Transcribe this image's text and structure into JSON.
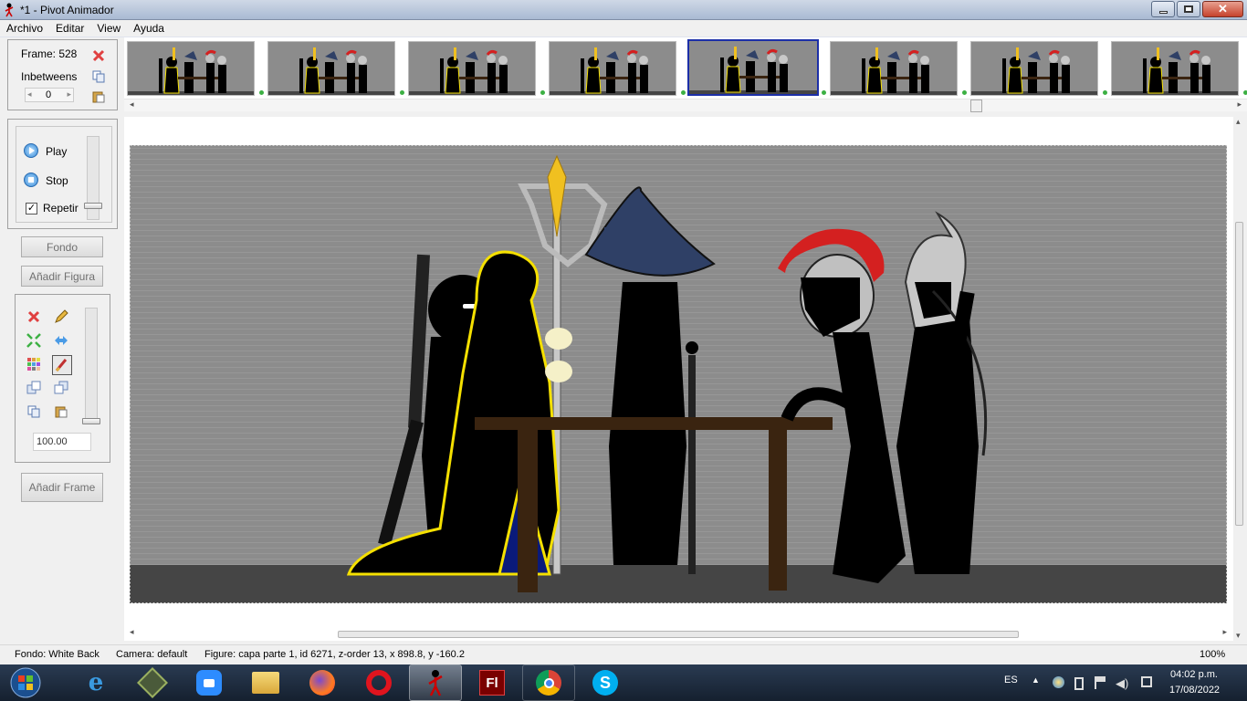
{
  "window": {
    "title": "*1 - Pivot Animador"
  },
  "menu": [
    "Archivo",
    "Editar",
    "View",
    "Ayuda"
  ],
  "frame_panel": {
    "frame_label": "Frame: 528",
    "inbetweens_label": "Inbetweens",
    "inbetweens_value": "0"
  },
  "playback": {
    "play": "Play",
    "stop": "Stop",
    "repeat": "Repetir",
    "repeat_checked": true
  },
  "buttons": {
    "background": "Fondo",
    "add_figure": "Añadir Figura",
    "add_frame": "Añadir Frame"
  },
  "figure_tools": {
    "scale_value": "100.00"
  },
  "icons": [
    "delete-icon",
    "copy-icon",
    "paste-icon",
    "pencil-icon",
    "flip-icon",
    "color-icon",
    "brush-icon",
    "play-icon",
    "stop-icon"
  ],
  "frames": {
    "count": 8,
    "selected": 5
  },
  "status": {
    "fondo": "Fondo: White Back",
    "camera": "Camera: default",
    "figure": "Figure: capa parte 1,  id 6271,  z-order 13,  x 898.8, y -160.2",
    "zoom": "100%"
  },
  "taskbar": {
    "language": "ES",
    "time": "04:02 p.m.",
    "date": "17/08/2022"
  },
  "colors": {
    "selected_frame": "#1c2fa8",
    "stage_bg": "#8a8a8a",
    "floor": "#454545",
    "table": "#3a2410"
  }
}
